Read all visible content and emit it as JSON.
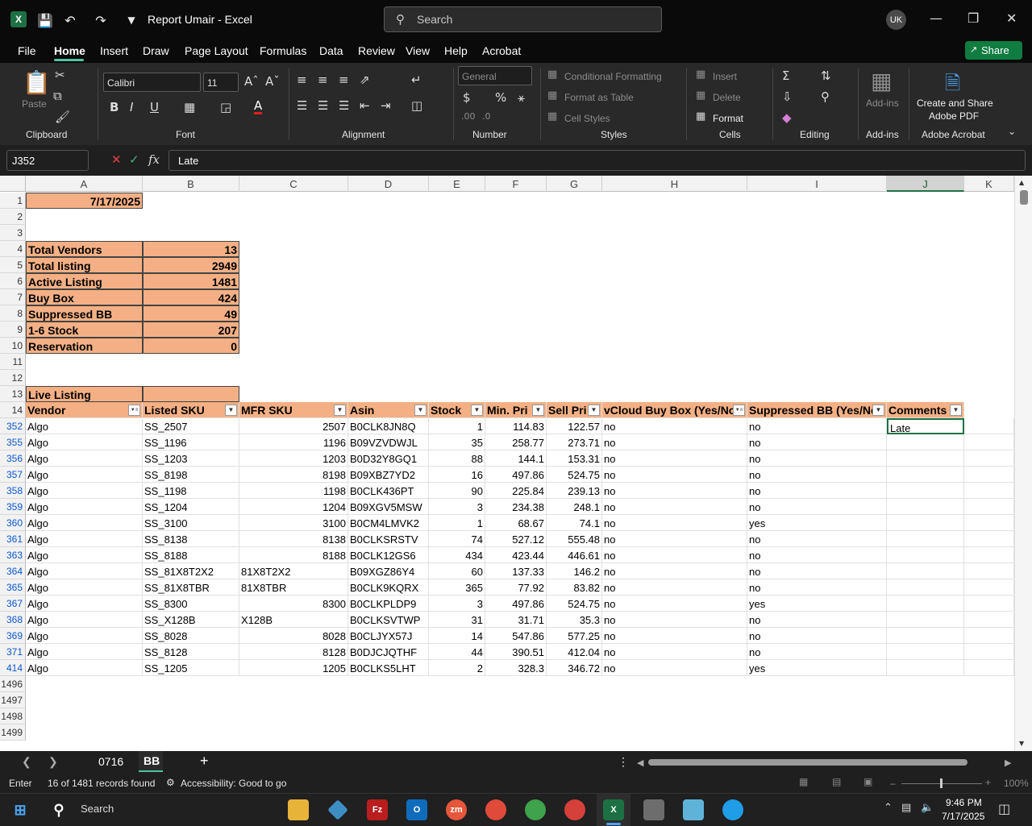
{
  "window": {
    "title": "Report Umair  -  Excel",
    "search_placeholder": "Search",
    "avatar": "UK"
  },
  "menu": [
    "File",
    "Home",
    "Insert",
    "Draw",
    "Page Layout",
    "Formulas",
    "Data",
    "Review",
    "View",
    "Help",
    "Acrobat"
  ],
  "share_label": "Share",
  "ribbon": {
    "clipboard": {
      "label": "Clipboard",
      "paste": "Paste"
    },
    "font": {
      "label": "Font",
      "name": "Calibri",
      "size": "11"
    },
    "alignment": {
      "label": "Alignment"
    },
    "number": {
      "label": "Number",
      "format": "General"
    },
    "styles": {
      "label": "Styles",
      "conditional": "Conditional Formatting",
      "format_table": "Format as Table",
      "cell_styles": "Cell Styles"
    },
    "cells": {
      "label": "Cells",
      "insert": "Insert",
      "delete": "Delete",
      "format": "Format"
    },
    "editing": {
      "label": "Editing"
    },
    "addins": {
      "label": "Add-ins",
      "button": "Add-ins"
    },
    "acrobat": {
      "label": "Adobe Acrobat",
      "button_line1": "Create and Share",
      "button_line2": "Adobe PDF"
    }
  },
  "formula_bar": {
    "name_box": "J352",
    "content": "Late"
  },
  "columns": [
    "A",
    "B",
    "C",
    "D",
    "E",
    "F",
    "G",
    "H",
    "I",
    "J",
    "K"
  ],
  "selected_column": "J",
  "summary": {
    "date": "7/17/2025",
    "rows": [
      {
        "label": "Total Vendors",
        "value": "13"
      },
      {
        "label": "Total listing",
        "value": "2949"
      },
      {
        "label": "Active Listing",
        "value": "1481"
      },
      {
        "label": "Buy Box",
        "value": "424"
      },
      {
        "label": "Suppressed BB",
        "value": "49"
      },
      {
        "label": "1-6 Stock",
        "value": "207"
      },
      {
        "label": "Reservation",
        "value": "0"
      }
    ],
    "live_listing": "Live Listing"
  },
  "table": {
    "headers": [
      "Vendor",
      "Listed SKU",
      "MFR SKU",
      "Asin",
      "Stock",
      "Min. Pri",
      "Sell Pri",
      "vCloud Buy Box (Yes/No",
      "Suppressed BB (Yes/No",
      "Comments"
    ],
    "rows": [
      {
        "row": "352",
        "vendor": "Algo",
        "sku": "SS_2507",
        "mfr": "2507",
        "asin": "B0CLK8JN8Q",
        "stock": "1",
        "min": "114.83",
        "sell": "122.57",
        "bb": "no",
        "supp": "no",
        "comment": "Late"
      },
      {
        "row": "355",
        "vendor": "Algo",
        "sku": "SS_1196",
        "mfr": "1196",
        "asin": "B09VZVDWJL",
        "stock": "35",
        "min": "258.77",
        "sell": "273.71",
        "bb": "no",
        "supp": "no",
        "comment": ""
      },
      {
        "row": "356",
        "vendor": "Algo",
        "sku": "SS_1203",
        "mfr": "1203",
        "asin": "B0D32Y8GQ1",
        "stock": "88",
        "min": "144.1",
        "sell": "153.31",
        "bb": "no",
        "supp": "no",
        "comment": ""
      },
      {
        "row": "357",
        "vendor": "Algo",
        "sku": "SS_8198",
        "mfr": "8198",
        "asin": "B09XBZ7YD2",
        "stock": "16",
        "min": "497.86",
        "sell": "524.75",
        "bb": "no",
        "supp": "no",
        "comment": ""
      },
      {
        "row": "358",
        "vendor": "Algo",
        "sku": "SS_1198",
        "mfr": "1198",
        "asin": "B0CLK436PT",
        "stock": "90",
        "min": "225.84",
        "sell": "239.13",
        "bb": "no",
        "supp": "no",
        "comment": ""
      },
      {
        "row": "359",
        "vendor": "Algo",
        "sku": "SS_1204",
        "mfr": "1204",
        "asin": "B09XGV5MSW",
        "stock": "3",
        "min": "234.38",
        "sell": "248.1",
        "bb": "no",
        "supp": "no",
        "comment": ""
      },
      {
        "row": "360",
        "vendor": "Algo",
        "sku": "SS_3100",
        "mfr": "3100",
        "asin": "B0CM4LMVK2",
        "stock": "1",
        "min": "68.67",
        "sell": "74.1",
        "bb": "no",
        "supp": "yes",
        "comment": ""
      },
      {
        "row": "361",
        "vendor": "Algo",
        "sku": "SS_8138",
        "mfr": "8138",
        "asin": "B0CLKSRSTV",
        "stock": "74",
        "min": "527.12",
        "sell": "555.48",
        "bb": "no",
        "supp": "no",
        "comment": ""
      },
      {
        "row": "363",
        "vendor": "Algo",
        "sku": "SS_8188",
        "mfr": "8188",
        "asin": "B0CLK12GS6",
        "stock": "434",
        "min": "423.44",
        "sell": "446.61",
        "bb": "no",
        "supp": "no",
        "comment": ""
      },
      {
        "row": "364",
        "vendor": "Algo",
        "sku": "SS_81X8T2X2",
        "mfr": "81X8T2X2",
        "asin": "B09XGZ86Y4",
        "stock": "60",
        "min": "137.33",
        "sell": "146.2",
        "bb": "no",
        "supp": "no",
        "comment": ""
      },
      {
        "row": "365",
        "vendor": "Algo",
        "sku": "SS_81X8TBR",
        "mfr": "81X8TBR",
        "asin": "B0CLK9KQRX",
        "stock": "365",
        "min": "77.92",
        "sell": "83.82",
        "bb": "no",
        "supp": "no",
        "comment": ""
      },
      {
        "row": "367",
        "vendor": "Algo",
        "sku": "SS_8300",
        "mfr": "8300",
        "asin": "B0CLKPLDP9",
        "stock": "3",
        "min": "497.86",
        "sell": "524.75",
        "bb": "no",
        "supp": "yes",
        "comment": ""
      },
      {
        "row": "368",
        "vendor": "Algo",
        "sku": "SS_X128B",
        "mfr": "X128B",
        "asin": "B0CLKSVTWP",
        "stock": "31",
        "min": "31.71",
        "sell": "35.3",
        "bb": "no",
        "supp": "no",
        "comment": ""
      },
      {
        "row": "369",
        "vendor": "Algo",
        "sku": "SS_8028",
        "mfr": "8028",
        "asin": "B0CLJYX57J",
        "stock": "14",
        "min": "547.86",
        "sell": "577.25",
        "bb": "no",
        "supp": "no",
        "comment": ""
      },
      {
        "row": "371",
        "vendor": "Algo",
        "sku": "SS_8128",
        "mfr": "8128",
        "asin": "B0DJCJQTHF",
        "stock": "44",
        "min": "390.51",
        "sell": "412.04",
        "bb": "no",
        "supp": "no",
        "comment": ""
      },
      {
        "row": "414",
        "vendor": "Algo",
        "sku": "SS_1205",
        "mfr": "1205",
        "asin": "B0CLKS5LHT",
        "stock": "2",
        "min": "328.3",
        "sell": "346.72",
        "bb": "no",
        "supp": "yes",
        "comment": ""
      }
    ],
    "trailing_rows": [
      "1496",
      "1497",
      "1498",
      "1499"
    ]
  },
  "sheets": {
    "tabs": [
      "0716",
      "BB"
    ],
    "active": "BB"
  },
  "status": {
    "mode": "Enter",
    "records": "16 of 1481 records found",
    "accessibility": "Accessibility: Good to go",
    "zoom": "100%"
  },
  "taskbar": {
    "search": "Search",
    "time": "9:46 PM",
    "date": "7/17/2025"
  }
}
